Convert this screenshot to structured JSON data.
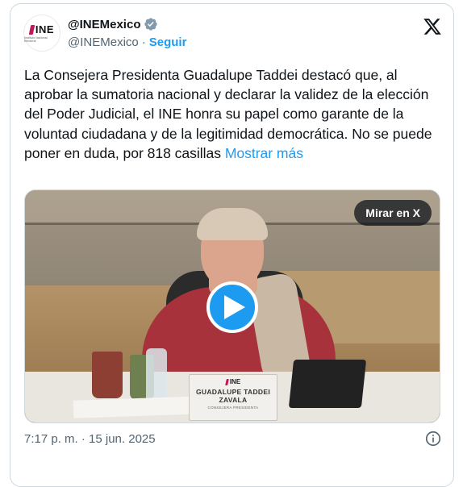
{
  "account": {
    "display_name": "@INEMexico",
    "handle": "@INEMexico",
    "separator": "·",
    "follow_label": "Seguir",
    "logo_text": "INE",
    "logo_subtext": "Instituto Nacional Electoral"
  },
  "tweet": {
    "text": "La Consejera Presidenta Guadalupe Taddei destacó que, al aprobar la sumatoria nacional y declarar la validez de la elección del Poder Judicial, el INE honra su papel como garante de la voluntad ciudadana y de la legitimidad democrática. No se puede poner en duda, por 818 casillas",
    "show_more": "Mostrar más"
  },
  "video": {
    "watch_label": "Mirar en X",
    "nameplate_logo": "INE",
    "nameplate_name": "GUADALUPE TADDEI ZAVALA",
    "nameplate_role": "CONSEJERA PRESIDENTA"
  },
  "footer": {
    "timestamp": "7:17 p. m. · 15 jun. 2025"
  },
  "colors": {
    "accent": "#1d9bf0",
    "verified": "#829aab",
    "text": "#0f1419",
    "muted": "#536471",
    "border": "#cfd9de"
  },
  "icons": [
    "verified-badge-icon",
    "x-logo-icon",
    "play-icon",
    "info-icon"
  ]
}
